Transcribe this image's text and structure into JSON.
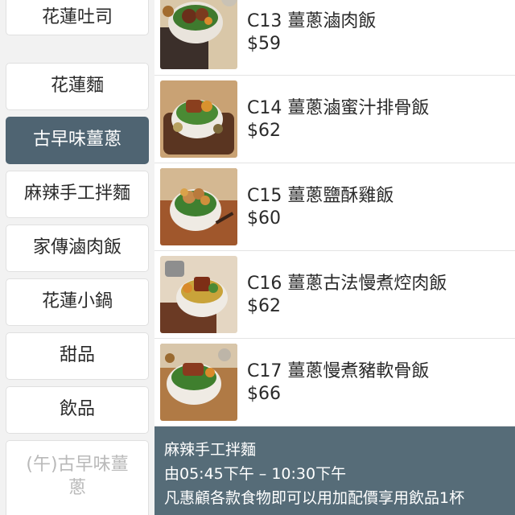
{
  "categories": [
    {
      "label": "花蓮吐司",
      "state": "normal"
    },
    {
      "label": "花蓮麵",
      "state": "normal"
    },
    {
      "label": "古早味薑蔥",
      "state": "active"
    },
    {
      "label": "麻辣手工拌麵",
      "state": "normal"
    },
    {
      "label": "家傳滷肉飯",
      "state": "normal"
    },
    {
      "label": "花蓮小鍋",
      "state": "normal"
    },
    {
      "label": "甜品",
      "state": "normal"
    },
    {
      "label": "飲品",
      "state": "normal"
    },
    {
      "label": "(午)古早味薑蔥",
      "state": "disabled"
    }
  ],
  "items": [
    {
      "name": "C13 薑蔥滷肉飯",
      "price": "$59"
    },
    {
      "name": "C14 薑蔥滷蜜汁排骨飯",
      "price": "$62"
    },
    {
      "name": "C15 薑蔥鹽酥雞飯",
      "price": "$60"
    },
    {
      "name": "C16 薑蔥古法慢煮焢肉飯",
      "price": "$62"
    },
    {
      "name": "C17 薑蔥慢煮豬軟骨飯",
      "price": "$66"
    }
  ],
  "banner": {
    "title": "麻辣手工拌麵",
    "hours": "由05:45下午 – 10:30下午",
    "promo": "凡惠顧各款食物即可以用加配價享用飲品1杯"
  },
  "colors": {
    "active_bg": "#4f6472",
    "banner_bg": "#566c78",
    "sidebar_bg": "#f2f2f2"
  }
}
